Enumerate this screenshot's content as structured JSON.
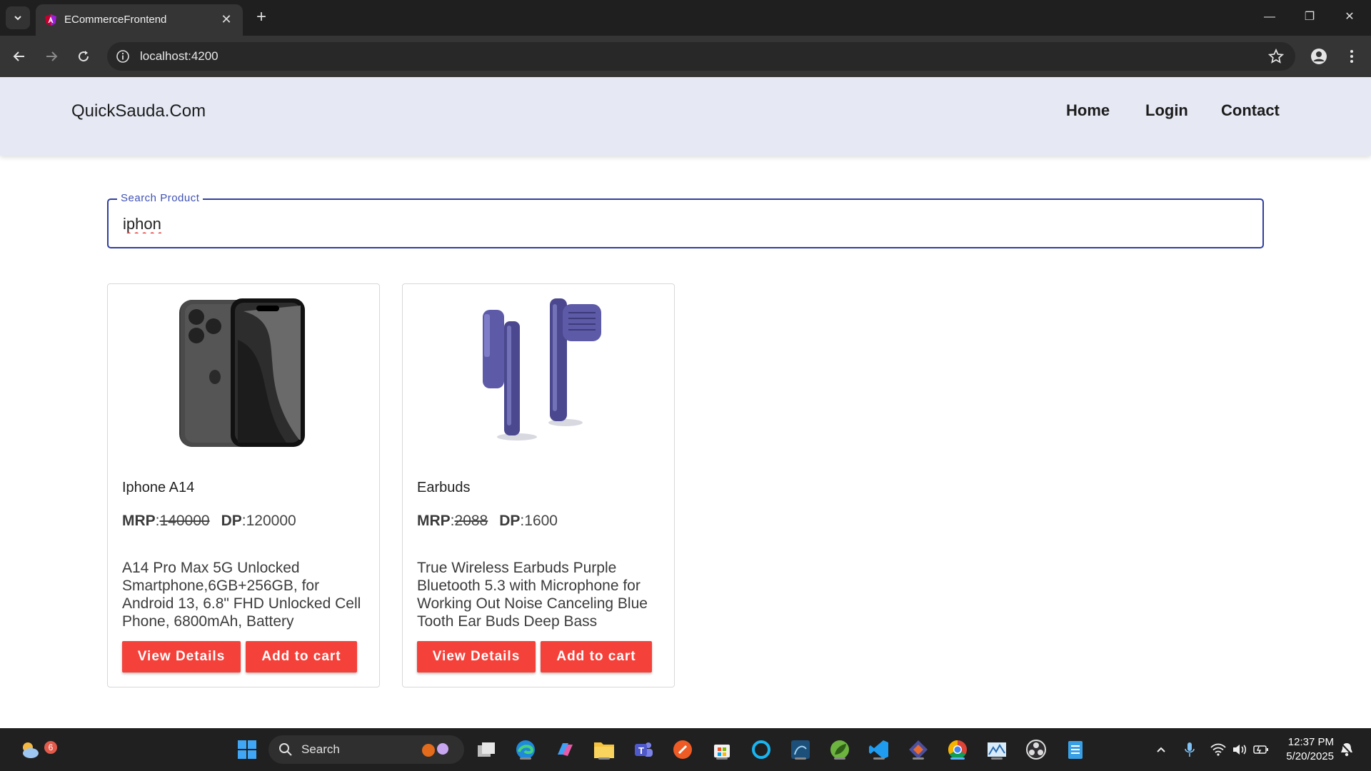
{
  "browser": {
    "tab_title": "ECommerceFrontend",
    "url": "localhost:4200"
  },
  "navbar": {
    "brand": "QuickSauda.Com",
    "links": [
      "Home",
      "Login",
      "Contact"
    ]
  },
  "search": {
    "label": "Search Product",
    "value": "iphon"
  },
  "products": [
    {
      "name": "Iphone A14",
      "mrp_label": "MRP",
      "mrp": "140000",
      "dp_label": "DP",
      "dp": "120000",
      "description": "A14 Pro Max 5G Unlocked Smartphone,6GB+256GB, for Android 13, 6.8\" FHD Unlocked Cell Phone, 6800mAh, Battery",
      "view_label": "View Details",
      "cart_label": "Add to cart"
    },
    {
      "name": "Earbuds",
      "mrp_label": "MRP",
      "mrp": "2088",
      "dp_label": "DP",
      "dp": "1600",
      "description": "True Wireless Earbuds Purple Bluetooth 5.3 with Microphone for Working Out Noise Canceling Blue Tooth Ear Buds Deep Bass",
      "view_label": "View Details",
      "cart_label": "Add to cart"
    }
  ],
  "taskbar": {
    "search_label": "Search",
    "weather_badge": "6",
    "time": "12:37 PM",
    "date": "5/20/2025"
  },
  "colors": {
    "navbar_bg": "#e6e9f4",
    "accent_button": "#f4413a",
    "search_border": "#2f3fa0"
  }
}
